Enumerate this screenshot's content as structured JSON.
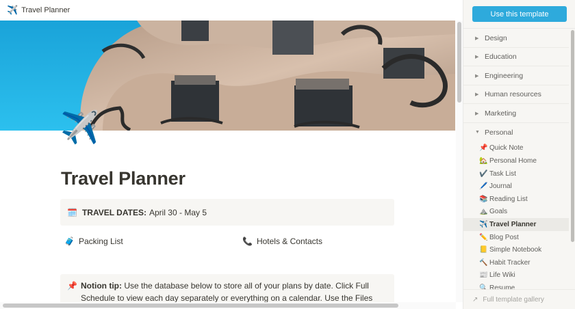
{
  "topbar": {
    "icon": "✈️",
    "title": "Travel Planner"
  },
  "page": {
    "icon": "✈️",
    "title": "Travel Planner",
    "dates": {
      "icon": "🗓️",
      "label": "TRAVEL DATES:",
      "value": "April 30 - May 5"
    },
    "packing": {
      "icon": "🧳",
      "label": "Packing List"
    },
    "hotels": {
      "icon": "📞",
      "label": "Hotels & Contacts"
    },
    "tip": {
      "icon": "📌",
      "label": "Notion tip:",
      "text": "Use the database below to store all of your plans by date. Click Full Schedule to view each day separately or everything on a calendar. Use the Files column to keep"
    }
  },
  "sidebar": {
    "use_template": "Use this template",
    "categories": [
      {
        "label": "Design"
      },
      {
        "label": "Education"
      },
      {
        "label": "Engineering"
      },
      {
        "label": "Human resources"
      },
      {
        "label": "Marketing"
      },
      {
        "label": "Personal"
      }
    ],
    "templates": [
      {
        "icon": "📌",
        "label": "Quick Note"
      },
      {
        "icon": "🏡",
        "label": "Personal Home"
      },
      {
        "icon": "✔️",
        "label": "Task List"
      },
      {
        "icon": "🖊️",
        "label": "Journal"
      },
      {
        "icon": "📚",
        "label": "Reading List"
      },
      {
        "icon": "⛰️",
        "label": "Goals"
      },
      {
        "icon": "✈️",
        "label": "Travel Planner"
      },
      {
        "icon": "✏️",
        "label": "Blog Post"
      },
      {
        "icon": "📒",
        "label": "Simple Notebook"
      },
      {
        "icon": "🔨",
        "label": "Habit Tracker"
      },
      {
        "icon": "📰",
        "label": "Life Wiki"
      },
      {
        "icon": "🔍",
        "label": "Resume"
      }
    ],
    "gallery_link": "Full template gallery"
  }
}
